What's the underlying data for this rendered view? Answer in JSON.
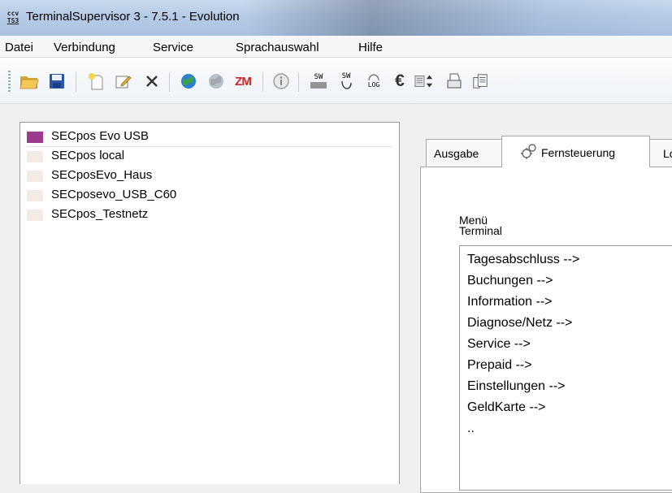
{
  "window": {
    "title": "TerminalSupervisor 3 - 7.5.1 - Evolution",
    "icon_top": "ccv",
    "icon_bottom": "TS3"
  },
  "menubar": {
    "items": [
      "Datei",
      "Verbindung",
      "Service",
      "Sprachauswahl",
      "Hilfe"
    ]
  },
  "toolbar": {
    "icons": [
      "open-folder-icon",
      "save-icon",
      "new-icon",
      "edit-icon",
      "delete-icon",
      "connect-globe-icon",
      "disconnect-globe-icon",
      "zm-icon",
      "info-icon",
      "sw-download-icon",
      "sw-update-icon",
      "log-icon",
      "euro-icon",
      "transfer-icon",
      "printer-icon",
      "report-icon"
    ],
    "zm_label": "ZM",
    "euro_label": "€",
    "sw1_label": "SW",
    "sw2_label": "SW",
    "log_label": "LOG"
  },
  "terminals": {
    "items": [
      {
        "label": "SECpos Evo USB",
        "color": "#9b3b8e",
        "selected": true
      },
      {
        "label": "SECpos local",
        "color": "#f4ebe8",
        "selected": false
      },
      {
        "label": "SECposEvo_Haus",
        "color": "#f4ebe8",
        "selected": false
      },
      {
        "label": "SECposevo_USB_C60",
        "color": "#f4ebe8",
        "selected": false
      },
      {
        "label": "SECpos_Testnetz",
        "color": "#f4ebe8",
        "selected": false
      }
    ]
  },
  "tabs": [
    {
      "label": "Ausgabe",
      "active": false
    },
    {
      "label": "Fernsteuerung",
      "active": true,
      "icon": "remote-control-icon"
    },
    {
      "label": "Lo",
      "active": false
    }
  ],
  "remote": {
    "menu_label": "Menü",
    "terminal_label": "Terminal",
    "menu_items": [
      "Tagesabschluss -->",
      "Buchungen -->",
      "Information -->",
      "Diagnose/Netz -->",
      "Service -->",
      "Prepaid -->",
      "Einstellungen -->",
      "GeldKarte -->",
      ".."
    ]
  }
}
